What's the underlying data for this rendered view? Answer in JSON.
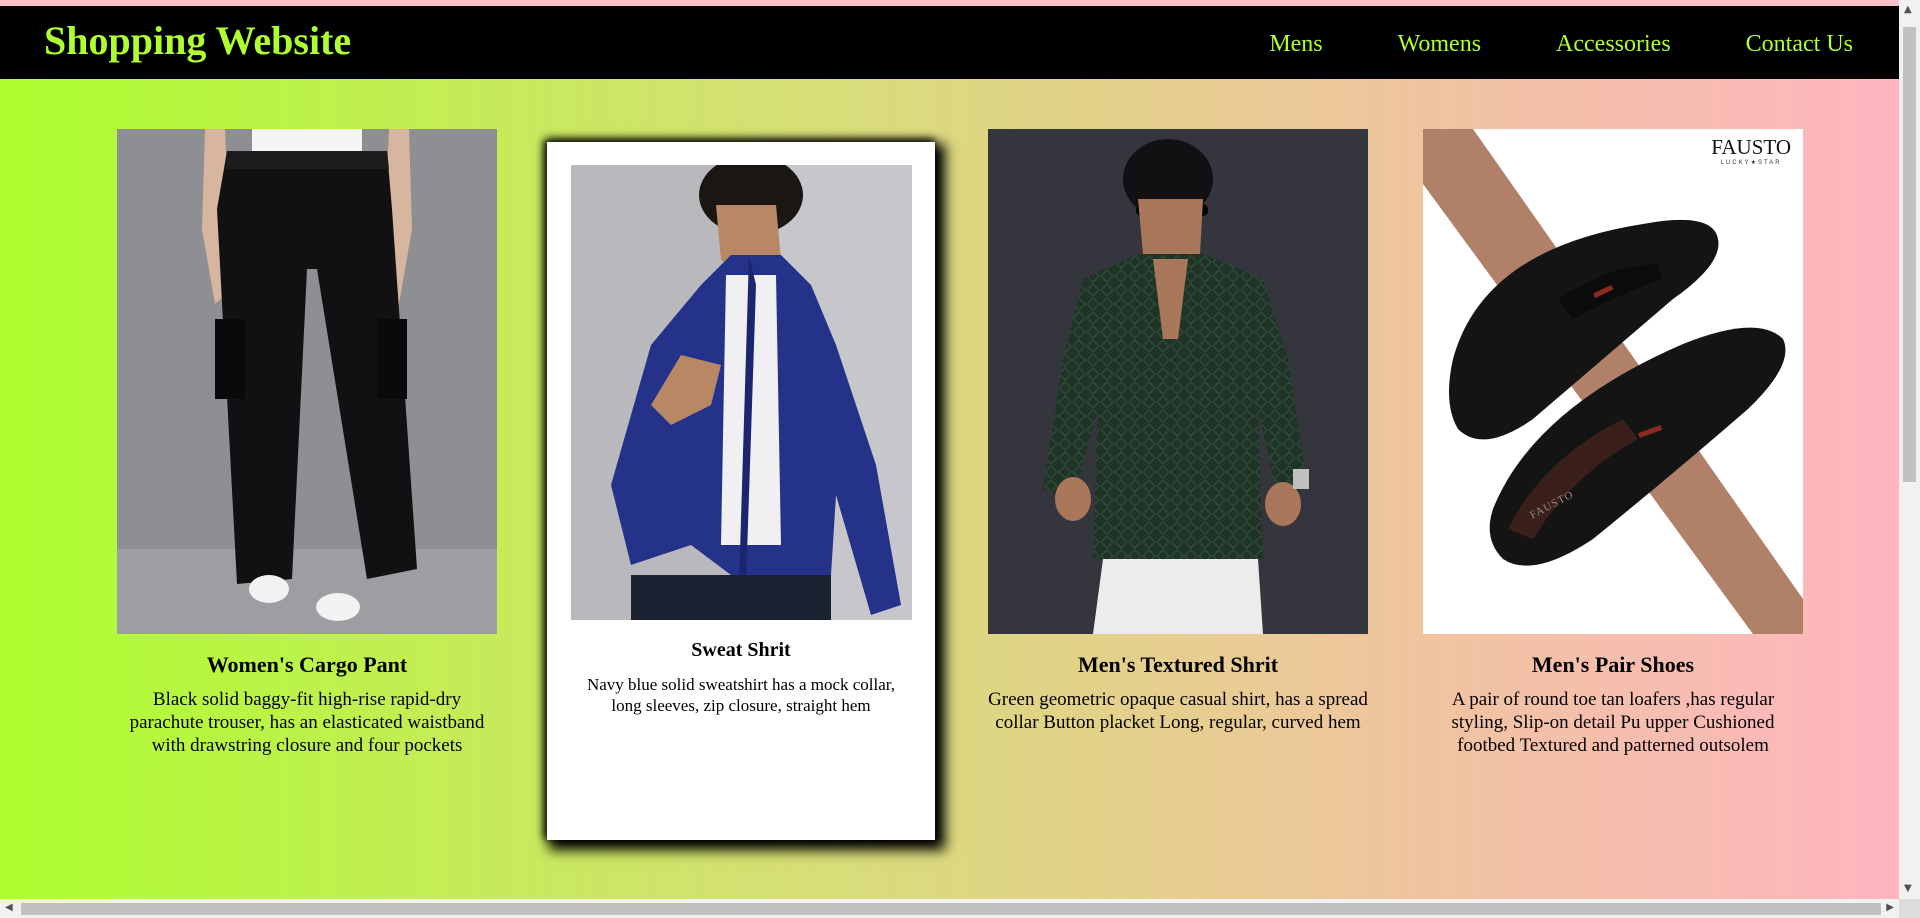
{
  "header": {
    "brand": "Shopping Website",
    "nav": [
      {
        "label": "Mens"
      },
      {
        "label": "Womens"
      },
      {
        "label": "Accessories"
      },
      {
        "label": "Contact Us"
      }
    ]
  },
  "products": [
    {
      "title": "Women's Cargo Pant",
      "description": "Black solid baggy-fit high-rise rapid-dry parachute trouser, has an elasticated waistband with drawstring closure and four pockets",
      "image": "black-cargo-pants-photo"
    },
    {
      "title": "Sweat Shrit",
      "description": "Navy blue solid sweatshirt has a mock collar, long sleeves, zip closure, straight hem",
      "image": "navy-zip-sweatshirt-photo"
    },
    {
      "title": "Men's Textured Shrit",
      "description": "Green geometric opaque casual shirt, has a spread collar Button placket Long, regular, curved hem",
      "image": "green-textured-shirt-photo"
    },
    {
      "title": "Men's Pair Shoes",
      "description": "A pair of round toe tan loafers ,has regular styling, Slip-on detail Pu upper Cushioned footbed Textured and patterned outsolem",
      "image": "black-loafers-photo",
      "brand_logo": "FAUSTO",
      "brand_sub": "LUCKY★STAR",
      "shoe_text": "FAUSTO"
    }
  ],
  "colors": {
    "accent": "#adff2f",
    "nav_bg": "#000000",
    "gradient_end": "#ffb6c1"
  },
  "icons": {
    "scroll_up": "▲",
    "scroll_down": "▼",
    "scroll_left": "◀",
    "scroll_right": "▶"
  }
}
